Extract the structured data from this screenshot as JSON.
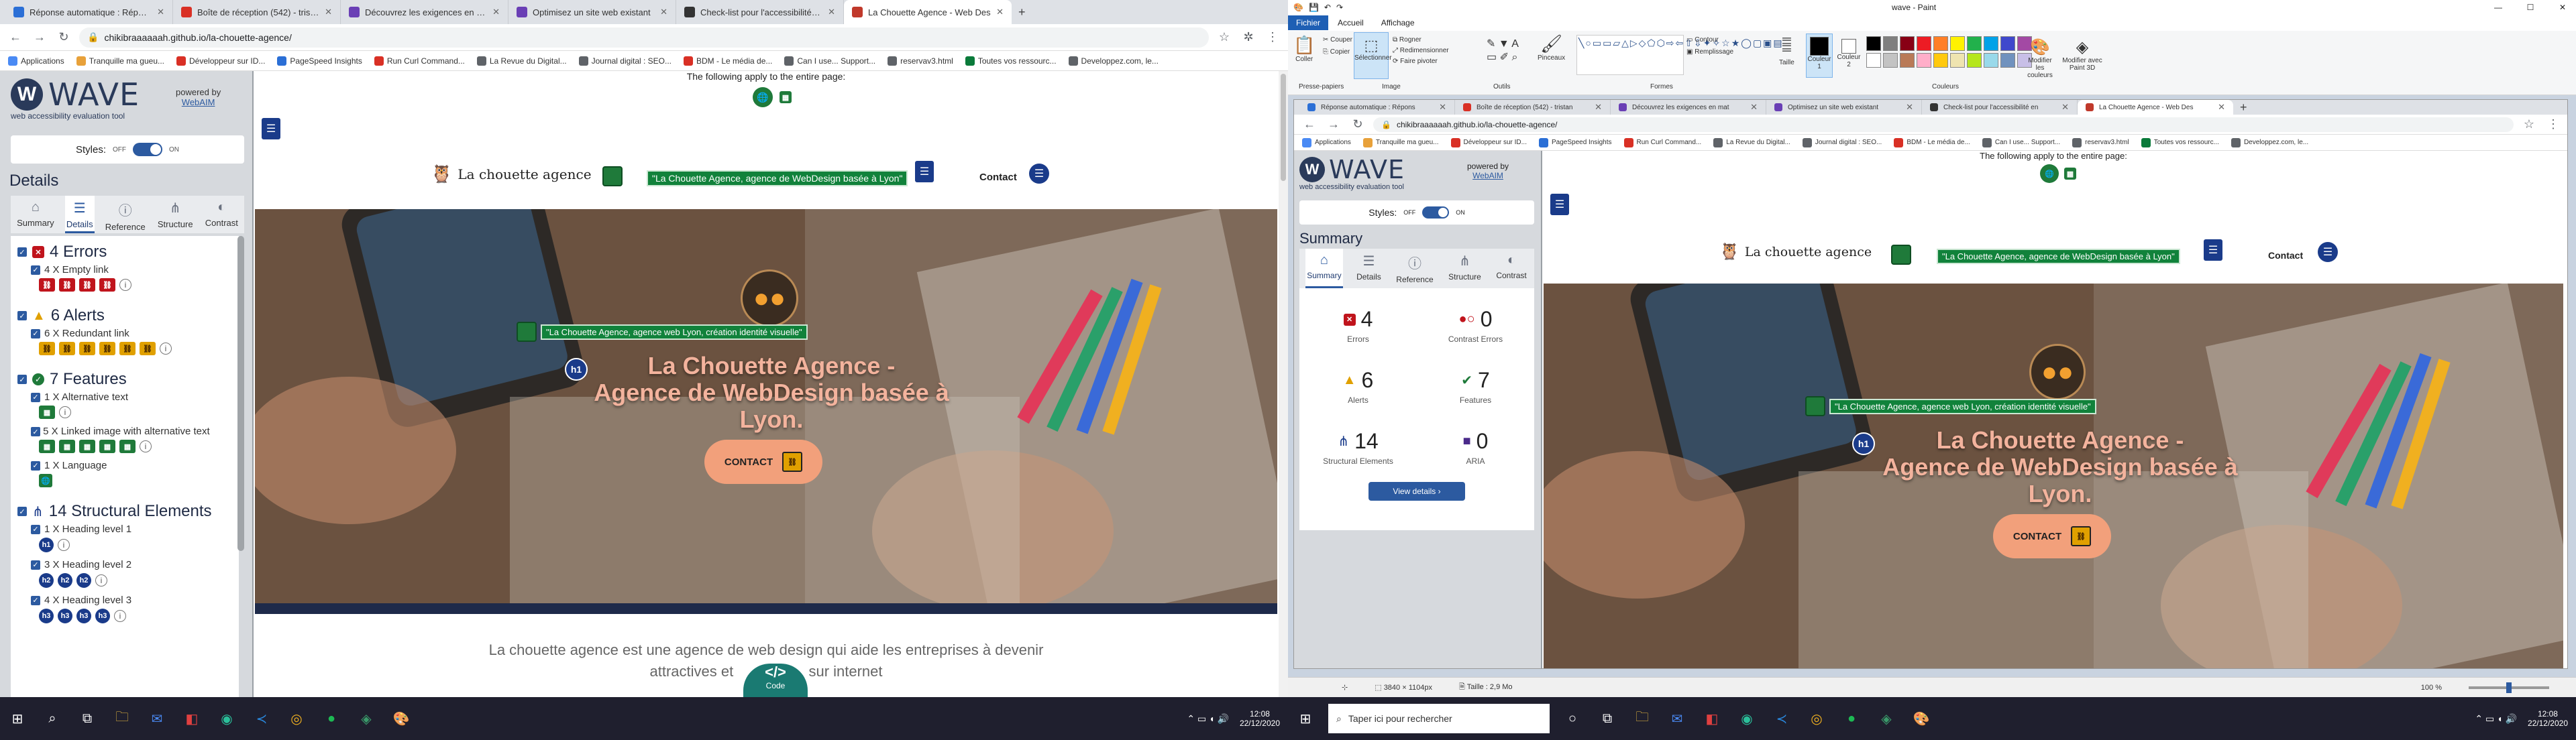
{
  "left_browser": {
    "tabs": [
      {
        "label": "Réponse automatique : Répons",
        "color": "#2b6fd6"
      },
      {
        "label": "Boîte de réception (542) - tristan",
        "color": "#d93025"
      },
      {
        "label": "Découvrez les exigences en mat",
        "color": "#6a3fb5"
      },
      {
        "label": "Optimisez un site web existant",
        "color": "#6a3fb5"
      },
      {
        "label": "Check-list pour l'accessibilité en",
        "color": "#333"
      },
      {
        "label": "La Chouette Agence - Web Des",
        "color": "#c0392b"
      }
    ],
    "url": "chikibraaaaaah.github.io/la-chouette-agence/",
    "bookmarks": [
      "Applications",
      "Tranquille ma gueu...",
      "Développeur sur ID...",
      "PageSpeed Insights",
      "Run Curl Command...",
      "La Revue du Digital...",
      "Journal digital : SEO...",
      "BDM - Le média de...",
      "Can I use... Support...",
      "reservav3.html",
      "Toutes vos ressourc...",
      "Developpez.com, le..."
    ]
  },
  "right_browser": {
    "tabs": [
      {
        "label": "Réponse automatique : Répons",
        "color": "#2b6fd6"
      },
      {
        "label": "Boîte de réception (542) - tristan",
        "color": "#d93025"
      },
      {
        "label": "Découvrez les exigences en mat",
        "color": "#6a3fb5"
      },
      {
        "label": "Optimisez un site web existant",
        "color": "#6a3fb5"
      },
      {
        "label": "Check-list pour l'accessibilité en",
        "color": "#333"
      },
      {
        "label": "La Chouette Agence - Web Des",
        "color": "#c0392b"
      }
    ],
    "url": "chikibraaaaaah.github.io/la-chouette-agence/",
    "bookmarks": [
      "Applications",
      "Tranquille ma gueu...",
      "Développeur sur ID...",
      "PageSpeed Insights",
      "Run Curl Command...",
      "La Revue du Digital...",
      "Journal digital : SEO...",
      "BDM - Le média de...",
      "Can I use... Support...",
      "reservav3.html",
      "Toutes vos ressourc...",
      "Developpez.com, le..."
    ]
  },
  "wave": {
    "logo": "WAVE",
    "tagline": "web accessibility evaluation tool",
    "powered_by": "powered by",
    "webaim": "WebAIM",
    "styles_label": "Styles:",
    "off": "OFF",
    "on": "ON",
    "details_heading": "Details",
    "summary_heading": "Summary",
    "tabs": [
      "Summary",
      "Details",
      "Reference",
      "Structure",
      "Contrast"
    ],
    "errors": "4 Errors",
    "errors_sub": "4 X Empty link",
    "alerts": "6 Alerts",
    "alerts_sub": "6 X Redundant link",
    "features": "7 Features",
    "feat_sub1": "1 X Alternative text",
    "feat_sub2": "5 X Linked image with alternative text",
    "feat_sub3": "1 X Language",
    "structural": "14 Structural Elements",
    "struct_sub1": "1 X Heading level 1",
    "struct_sub2": "3 X Heading level 2",
    "struct_sub3": "4 X Heading level 3",
    "summary": {
      "errors": "4",
      "errors_label": "Errors",
      "contrast": "0",
      "contrast_label": "Contrast Errors",
      "alerts": "6",
      "alerts_label": "Alerts",
      "features": "7",
      "features_label": "Features",
      "structural": "14",
      "structural_label": "Structural Elements",
      "aria": "0",
      "aria_label": "ARIA",
      "view_details": "View details ›"
    }
  },
  "page": {
    "apply_note": "The following apply to the entire page:",
    "brand": "La chouette agence",
    "brand_alt": "\"La Chouette Agence, agence de WebDesign basée à Lyon\"",
    "nav_contact": "Contact",
    "hero_alt": "\"La Chouette Agence, agence web Lyon, création identité visuelle\"",
    "hero_title_1": "La Chouette Agence -",
    "hero_title_2": "Agence de WebDesign basée à",
    "hero_title_3": "Lyon.",
    "h1_badge": "h1",
    "contact_btn": "CONTACT",
    "intro": "La chouette agence est une agence de web design qui aide les entreprises à devenir",
    "intro_2": "attractives et",
    "intro_3": "sur internet",
    "code_label": "Code"
  },
  "paint": {
    "title": "wave - Paint",
    "menu": [
      "Fichier",
      "Accueil",
      "Affichage"
    ],
    "clipboard": [
      "Coller",
      "Couper",
      "Copier"
    ],
    "clipboard_group": "Presse-papiers",
    "image_group": "Image",
    "select": "Sélectionner",
    "crop": "Rogner",
    "resize": "Redimensionner",
    "rotate": "Faire pivoter",
    "tools_group": "Outils",
    "brushes": "Pinceaux",
    "shapes_group": "Formes",
    "outline": "Contour",
    "fill": "Remplissage",
    "size": "Taille",
    "color1": "Couleur 1",
    "color2": "Couleur 2",
    "colors_group": "Couleurs",
    "edit_colors": "Modifier les couleurs",
    "paint3d": "Modifier avec Paint 3D",
    "status_dims": "3840 × 1104px",
    "status_size": "Taille : 2,9 Mo",
    "zoom": "100 %",
    "palette": [
      "#000000",
      "#7f7f7f",
      "#880015",
      "#ed1c24",
      "#ff7f27",
      "#fff200",
      "#22b14c",
      "#00a2e8",
      "#3f48cc",
      "#a349a4",
      "#ffffff",
      "#c3c3c3",
      "#b97a57",
      "#ffaec9",
      "#ffc90e",
      "#efe4b0",
      "#b5e61d",
      "#99d9ea",
      "#7092be",
      "#c8bfe7"
    ]
  },
  "taskbar": {
    "search": "Taper ici pour rechercher",
    "time": "12:08",
    "date": "22/12/2020"
  }
}
